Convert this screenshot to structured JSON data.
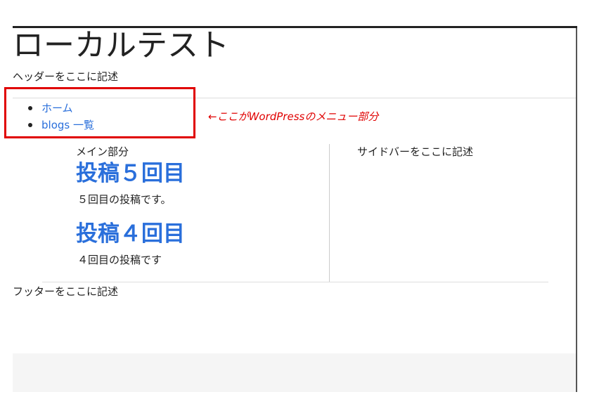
{
  "header": {
    "site_title": "ローカルテスト",
    "description": "ヘッダーをここに記述"
  },
  "nav": {
    "items": [
      {
        "label": "ホーム"
      },
      {
        "label": "blogs 一覧"
      }
    ]
  },
  "annotation": {
    "text": "←ここがWordPressのメニュー部分",
    "color": "#e00000"
  },
  "main": {
    "label": "メイン部分",
    "posts": [
      {
        "title": "投稿５回目",
        "body": "５回目の投稿です。"
      },
      {
        "title": "投稿４回目",
        "body": "４回目の投稿です"
      }
    ]
  },
  "sidebar": {
    "text": "サイドバーをここに記述"
  },
  "footer": {
    "text": "フッターをここに記述"
  },
  "colors": {
    "link": "#2a6fdb",
    "highlight_box": "#e00000",
    "text": "#222222"
  }
}
